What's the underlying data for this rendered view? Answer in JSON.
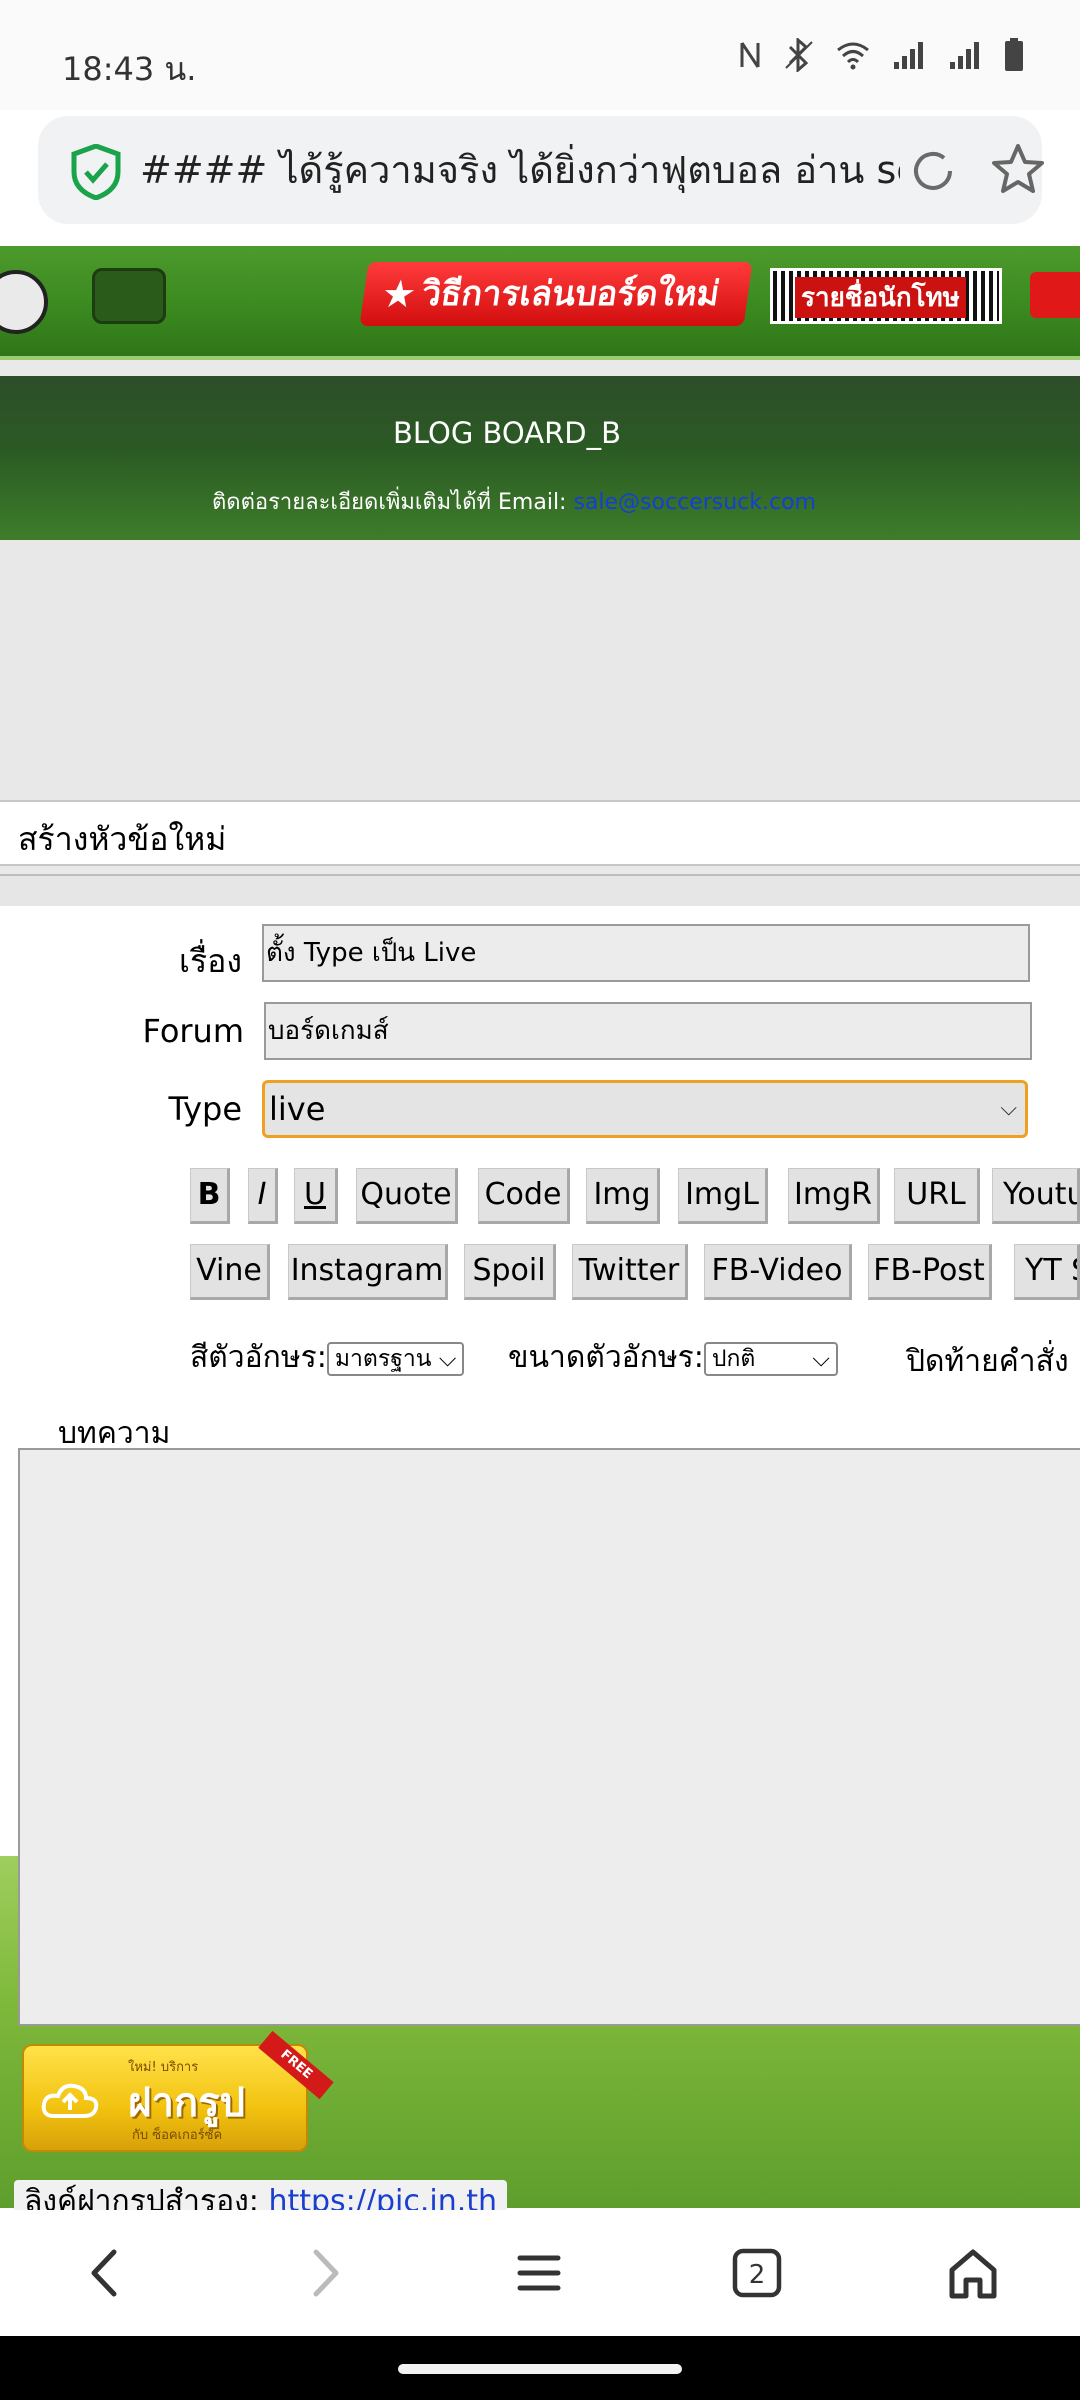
{
  "status_bar": {
    "time": "18:43 น.",
    "icons": [
      "nfc-icon",
      "bluetooth-icon",
      "wifi-icon",
      "signal-icon",
      "signal-icon",
      "battery-icon"
    ]
  },
  "url_bar": {
    "page_title": "#### ได้รู้ความจริง ได้ยิ่งกว่าฟุตบอล อ่าน sc"
  },
  "top_banner": {
    "how_to_play_label": "วิธีการเล่นบอร์ดใหม่",
    "banned_list_label": "รายชื่อนักโทษ"
  },
  "header": {
    "blog_title": "BLOG BOARD_B",
    "contact_text": "ติดต่อรายละเอียดเพิ่มเติมได้ที่ Email: ",
    "contact_email": "sale@soccersuck.com"
  },
  "section": {
    "new_topic_label": "สร้างหัวข้อใหม่"
  },
  "form": {
    "subject_label": "เรื่อง",
    "subject_value": "ตั้ง Type เป็น Live",
    "forum_label": "Forum",
    "forum_value": "บอร์ดเกมส์",
    "type_label": "Type",
    "type_value": "live",
    "toolbar_row1": [
      "B",
      "I",
      "U",
      "Quote",
      "Code",
      "Img",
      "ImgL",
      "ImgR",
      "URL",
      "Youtu"
    ],
    "toolbar_row2": [
      "Vine",
      "Instagram",
      "Spoil",
      "Twitter",
      "FB-Video",
      "FB-Post",
      "YT S"
    ],
    "font_color_label": "สีตัวอักษร:",
    "font_color_value": "มาตรฐาน",
    "font_size_label": "ขนาดตัวอักษร:",
    "font_size_value": "ปกติ",
    "close_tags_label": "ปิดท้ายคำสั่ง",
    "body_label": "บทความ",
    "body_value": ""
  },
  "upload_banner": {
    "top_text": "ใหม่! บริการ",
    "main_text": "ฝากรูป",
    "bottom_text": "กับ ซ็อคเกอร์ซัค",
    "ribbon_text": "FREE"
  },
  "alt_upload": {
    "label": "ลิงค์ฝากรูปสำรอง: ",
    "url": "https://pic.in.th"
  },
  "bottom_nav": {
    "tab_count": "2",
    "items": [
      "back-icon",
      "forward-icon",
      "menu-icon",
      "tabs-icon",
      "home-icon"
    ]
  }
}
